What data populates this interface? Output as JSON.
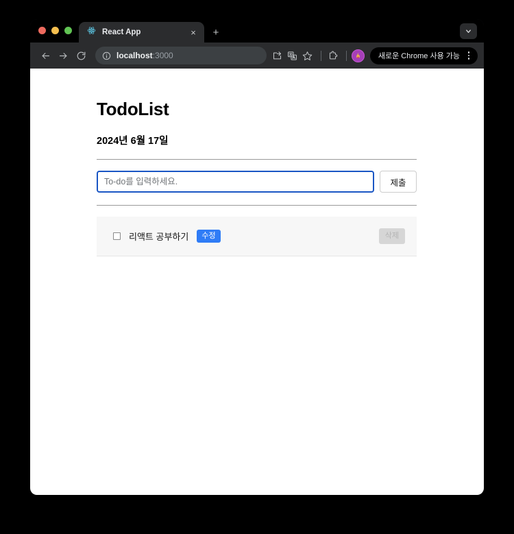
{
  "browser": {
    "tab": {
      "title": "React App",
      "favicon": "react-atom-icon",
      "close_label": "×"
    },
    "new_tab_label": "+",
    "toolbar": {
      "back_icon": "arrow-left-icon",
      "forward_icon": "arrow-right-icon",
      "reload_icon": "reload-icon",
      "site_info_icon": "info-circle-icon",
      "url_host": "localhost",
      "url_port": ":3000",
      "install_icon": "install-app-icon",
      "translate_icon": "translate-icon",
      "bookmark_icon": "star-icon",
      "extensions_icon": "puzzle-piece-icon",
      "avatar_icon": "profile-avatar-flame",
      "update_pill_label": "새로운 Chrome 사용 가능",
      "menu_icon": "three-dot-menu-icon"
    },
    "tab_search_icon": "chevron-down-icon",
    "window_controls": {
      "close_color": "#ED6A5E",
      "minimize_color": "#F5BF4F",
      "maximize_color": "#61C454"
    }
  },
  "page": {
    "title": "TodoList",
    "date": "2024년 6월 17일",
    "form": {
      "input_value": "",
      "input_placeholder": "To-do를 입력하세요.",
      "submit_label": "제출"
    },
    "todos": [
      {
        "text": "리액트 공부하기",
        "checked": false,
        "edit_label": "수정",
        "delete_label": "삭제",
        "delete_disabled": true
      }
    ],
    "colors": {
      "accent_blue": "#2F7CF6",
      "focus_border": "#1A56C4",
      "row_background": "#F7F7F7",
      "disabled_button": "#D6D6D6"
    }
  }
}
